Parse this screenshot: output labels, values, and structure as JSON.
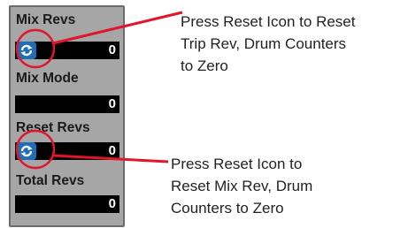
{
  "panel": {
    "fields": [
      {
        "label": "Mix Revs",
        "value": "0"
      },
      {
        "label": "Mix Mode",
        "value": "0"
      },
      {
        "label": "Reset Revs",
        "value": "0"
      },
      {
        "label": "Total Revs",
        "value": "0"
      }
    ]
  },
  "callouts": [
    {
      "lines": [
        "Press Reset Icon to Reset",
        "Trip Rev, Drum Counters",
        "to Zero"
      ]
    },
    {
      "lines": [
        "Press Reset Icon to",
        "Reset Mix Rev, Drum",
        "Counters to Zero"
      ]
    }
  ],
  "icons": {
    "reset": "reset-arrows-icon"
  },
  "colors": {
    "panel_bg": "#a6a6a6",
    "value_bg": "#000000",
    "reset_button": "#1f6fb8",
    "callout_line": "#e0162b"
  }
}
